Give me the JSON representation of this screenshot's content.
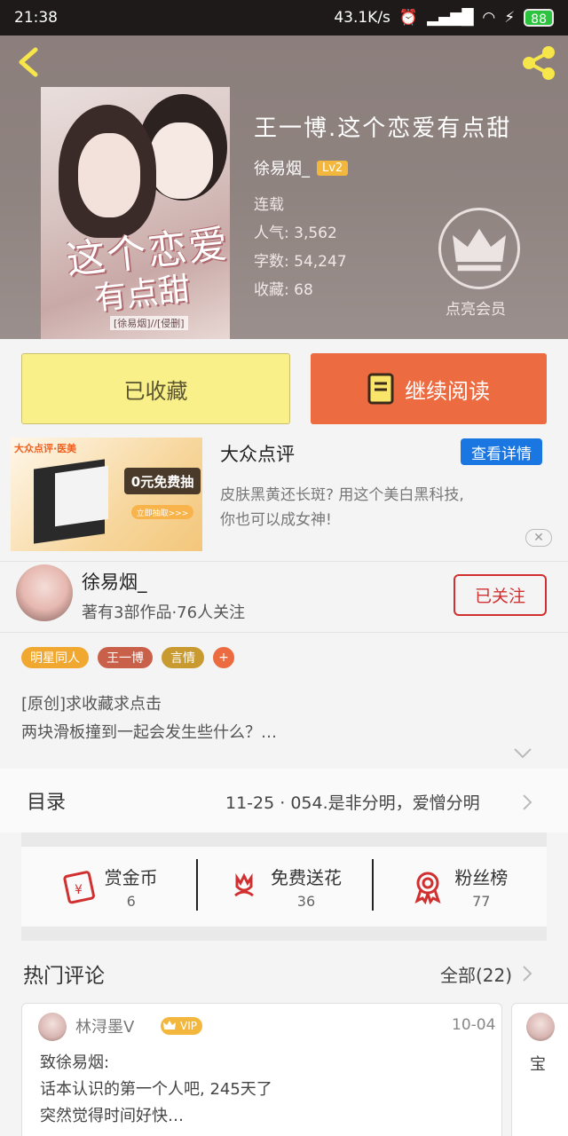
{
  "status_bar": {
    "time": "21:38",
    "speed": "43.1K/s",
    "battery": "88"
  },
  "book": {
    "title": "王一博.这个恋爱有点甜",
    "author": "徐易烟_",
    "level": "Lv2",
    "status": "连载",
    "popularity": "人气: 3,562",
    "word_count": "字数: 54,247",
    "favorites": "收藏: 68",
    "cover_title_line1": "这个恋爱",
    "cover_title_line2": "有点甜",
    "cover_tag": "[徐易烟]//[侵删]"
  },
  "vip_badge": {
    "label": "点亮会员"
  },
  "actions": {
    "saved_label": "已收藏",
    "continue_label": "继续阅读"
  },
  "ad": {
    "brand": "大众点评·医美",
    "free_text": "0元免费抽",
    "draw_text": "立即抽取>>>",
    "title": "大众点评",
    "button": "查看详情",
    "desc_line1": "皮肤黑黄还长斑? 用这个美白黑科技,",
    "desc_line2": "你也可以成女神!",
    "close": "✕"
  },
  "author_card": {
    "name": "徐易烟_",
    "subtitle": "著有3部作品·76人关注",
    "follow_label": "已关注"
  },
  "tags": [
    "明星同人",
    "王一博",
    "言情",
    "+"
  ],
  "description": {
    "line1": "[原创]求收藏求点击",
    "line2": "两块滑板撞到一起会发生些什么？…"
  },
  "toc": {
    "label": "目录",
    "latest": "11-25 · 054.是非分明，爱憎分明"
  },
  "stats": [
    {
      "label": "赏金币",
      "value": "6"
    },
    {
      "label": "免费送花",
      "value": "36"
    },
    {
      "label": "粉丝榜",
      "value": "77"
    }
  ],
  "comments_section": {
    "label": "热门评论",
    "all": "全部(22)"
  },
  "comment": {
    "user": "林浔墨V",
    "badge": "VIP",
    "date": "10-04",
    "line1": "致徐易烟:",
    "line2": "话本认识的第一个人吧, 245天了",
    "line3": "突然觉得时间好快…"
  },
  "comment2": {
    "text": "宝"
  },
  "colors": {
    "accent_orange": "#ec6b40",
    "saved_yellow": "#f9f08a",
    "blue_button": "#1a76e0",
    "follow_red": "#d03030"
  }
}
